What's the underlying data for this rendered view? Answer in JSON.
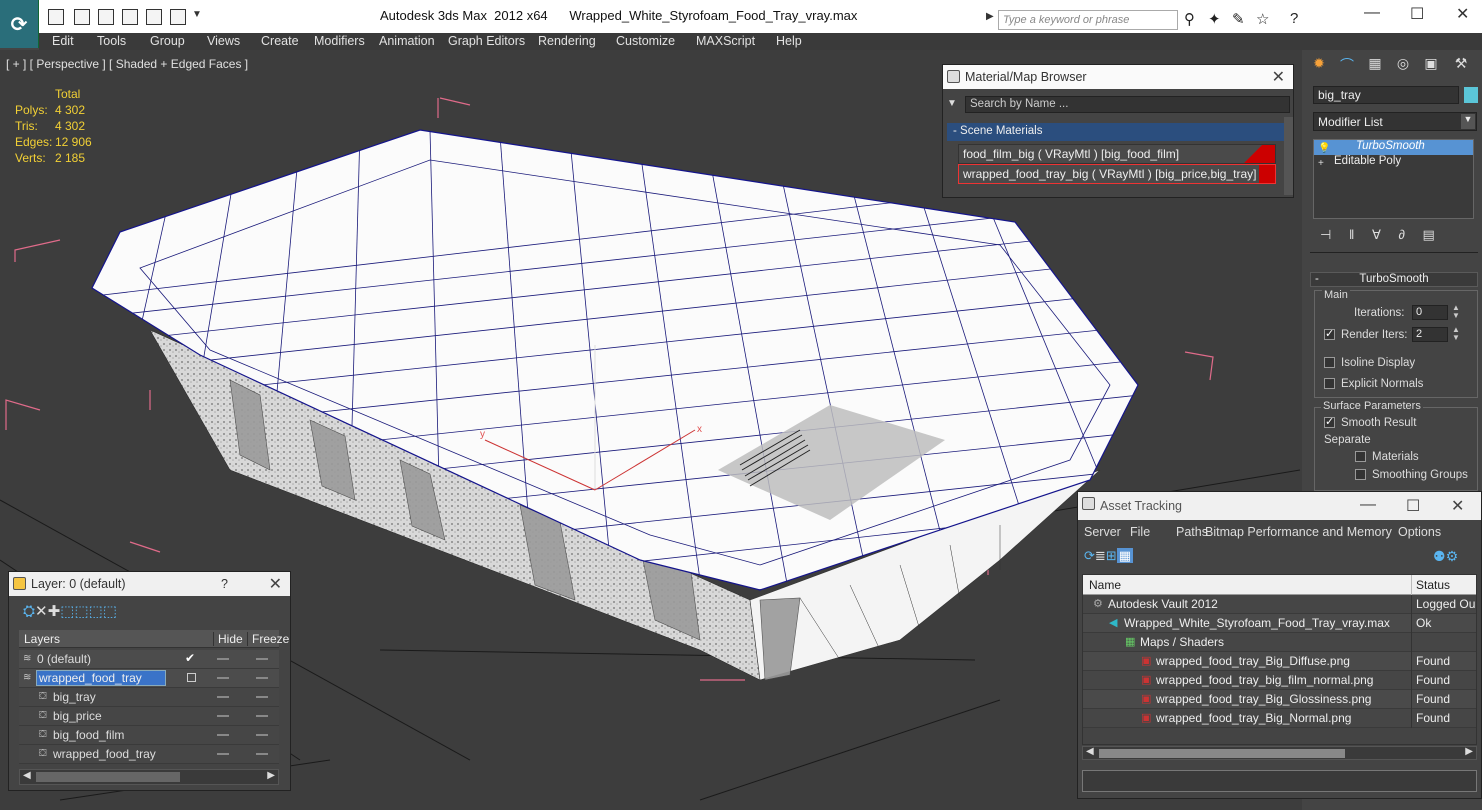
{
  "window": {
    "title": "Autodesk 3ds Max  2012 x64      Wrapped_White_Styrofoam_Food_Tray_vray.max",
    "search_placeholder": "Type a keyword or phrase"
  },
  "menu": [
    "Edit",
    "Tools",
    "Group",
    "Views",
    "Create",
    "Modifiers",
    "Animation",
    "Graph Editors",
    "Rendering",
    "Customize",
    "MAXScript",
    "Help"
  ],
  "viewport": {
    "label": "[ + ] [ Perspective ] [ Shaded + Edged Faces ]",
    "stats": {
      "header": "Total",
      "rows": [
        {
          "label": "Polys:",
          "value": "4 302"
        },
        {
          "label": "Tris:",
          "value": "4 302"
        },
        {
          "label": "Edges:",
          "value": "12 906"
        },
        {
          "label": "Verts:",
          "value": "2 185"
        }
      ]
    },
    "axis_x": "x",
    "axis_y": "y"
  },
  "material_browser": {
    "title": "Material/Map Browser",
    "search": "Search by Name ...",
    "section": "- Scene Materials",
    "items": [
      "food_film_big ( VRayMtl ) [big_food_film]",
      "wrapped_food_tray_big ( VRayMtl ) [big_price,big_tray]"
    ]
  },
  "command_panel": {
    "object_name": "big_tray",
    "modifier_list": "Modifier List",
    "stack": [
      "TurboSmooth",
      "Editable Poly"
    ],
    "rollout": "TurboSmooth",
    "main": "Main",
    "iterations_label": "Iterations:",
    "iterations": "0",
    "render_iters_label": "Render Iters:",
    "render_iters": "2",
    "isoline": "Isoline Display",
    "explicit": "Explicit Normals",
    "surface": "Surface Parameters",
    "smooth": "Smooth Result",
    "separate": "Separate",
    "materials": "Materials",
    "smoothing": "Smoothing Groups"
  },
  "layer": {
    "title": "Layer: 0 (default)",
    "help": "?",
    "col_layers": "Layers",
    "col_hide": "Hide",
    "col_freeze": "Freeze",
    "rows": [
      {
        "name": "0 (default)",
        "indent": 0
      },
      {
        "name": "wrapped_food_tray",
        "indent": 0
      },
      {
        "name": "big_tray",
        "indent": 1
      },
      {
        "name": "big_price",
        "indent": 1
      },
      {
        "name": "big_food_film",
        "indent": 1
      },
      {
        "name": "wrapped_food_tray",
        "indent": 1
      }
    ]
  },
  "asset": {
    "title": "Asset Tracking",
    "menu": [
      "Server",
      "File",
      "Paths",
      "Bitmap Performance and Memory",
      "Options"
    ],
    "col_name": "Name",
    "col_status": "Status",
    "rows": [
      {
        "name": "Autodesk Vault 2012",
        "status": "Logged Ou",
        "level": 0,
        "icon": "vault"
      },
      {
        "name": "Wrapped_White_Styrofoam_Food_Tray_vray.max",
        "status": "Ok",
        "level": 1,
        "icon": "max"
      },
      {
        "name": "Maps / Shaders",
        "status": "",
        "level": 2,
        "icon": "maps"
      },
      {
        "name": "wrapped_food_tray_Big_Diffuse.png",
        "status": "Found",
        "level": 3,
        "icon": "png"
      },
      {
        "name": "wrapped_food_tray_big_film_normal.png",
        "status": "Found",
        "level": 3,
        "icon": "png"
      },
      {
        "name": "wrapped_food_tray_Big_Glossiness.png",
        "status": "Found",
        "level": 3,
        "icon": "png"
      },
      {
        "name": "wrapped_food_tray_Big_Normal.png",
        "status": "Found",
        "level": 3,
        "icon": "png"
      }
    ]
  }
}
